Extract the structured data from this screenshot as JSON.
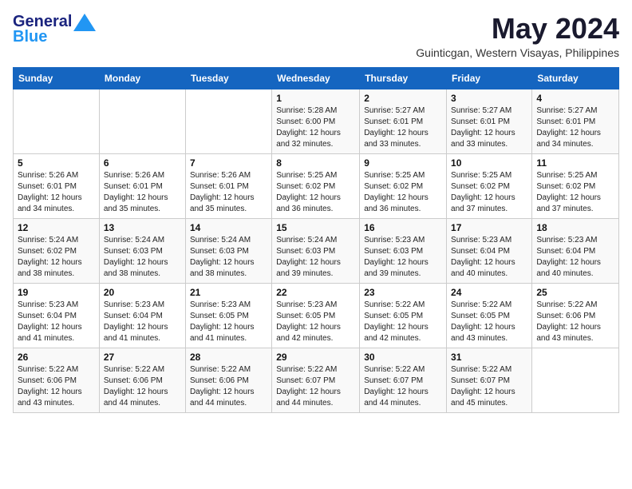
{
  "logo": {
    "general": "General",
    "blue": "Blue",
    "tagline": ""
  },
  "title": {
    "month_year": "May 2024",
    "location": "Guinticgan, Western Visayas, Philippines"
  },
  "header_days": [
    "Sunday",
    "Monday",
    "Tuesday",
    "Wednesday",
    "Thursday",
    "Friday",
    "Saturday"
  ],
  "weeks": [
    [
      {
        "day": "",
        "info": ""
      },
      {
        "day": "",
        "info": ""
      },
      {
        "day": "",
        "info": ""
      },
      {
        "day": "1",
        "info": "Sunrise: 5:28 AM\nSunset: 6:00 PM\nDaylight: 12 hours\nand 32 minutes."
      },
      {
        "day": "2",
        "info": "Sunrise: 5:27 AM\nSunset: 6:01 PM\nDaylight: 12 hours\nand 33 minutes."
      },
      {
        "day": "3",
        "info": "Sunrise: 5:27 AM\nSunset: 6:01 PM\nDaylight: 12 hours\nand 33 minutes."
      },
      {
        "day": "4",
        "info": "Sunrise: 5:27 AM\nSunset: 6:01 PM\nDaylight: 12 hours\nand 34 minutes."
      }
    ],
    [
      {
        "day": "5",
        "info": "Sunrise: 5:26 AM\nSunset: 6:01 PM\nDaylight: 12 hours\nand 34 minutes."
      },
      {
        "day": "6",
        "info": "Sunrise: 5:26 AM\nSunset: 6:01 PM\nDaylight: 12 hours\nand 35 minutes."
      },
      {
        "day": "7",
        "info": "Sunrise: 5:26 AM\nSunset: 6:01 PM\nDaylight: 12 hours\nand 35 minutes."
      },
      {
        "day": "8",
        "info": "Sunrise: 5:25 AM\nSunset: 6:02 PM\nDaylight: 12 hours\nand 36 minutes."
      },
      {
        "day": "9",
        "info": "Sunrise: 5:25 AM\nSunset: 6:02 PM\nDaylight: 12 hours\nand 36 minutes."
      },
      {
        "day": "10",
        "info": "Sunrise: 5:25 AM\nSunset: 6:02 PM\nDaylight: 12 hours\nand 37 minutes."
      },
      {
        "day": "11",
        "info": "Sunrise: 5:25 AM\nSunset: 6:02 PM\nDaylight: 12 hours\nand 37 minutes."
      }
    ],
    [
      {
        "day": "12",
        "info": "Sunrise: 5:24 AM\nSunset: 6:02 PM\nDaylight: 12 hours\nand 38 minutes."
      },
      {
        "day": "13",
        "info": "Sunrise: 5:24 AM\nSunset: 6:03 PM\nDaylight: 12 hours\nand 38 minutes."
      },
      {
        "day": "14",
        "info": "Sunrise: 5:24 AM\nSunset: 6:03 PM\nDaylight: 12 hours\nand 38 minutes."
      },
      {
        "day": "15",
        "info": "Sunrise: 5:24 AM\nSunset: 6:03 PM\nDaylight: 12 hours\nand 39 minutes."
      },
      {
        "day": "16",
        "info": "Sunrise: 5:23 AM\nSunset: 6:03 PM\nDaylight: 12 hours\nand 39 minutes."
      },
      {
        "day": "17",
        "info": "Sunrise: 5:23 AM\nSunset: 6:04 PM\nDaylight: 12 hours\nand 40 minutes."
      },
      {
        "day": "18",
        "info": "Sunrise: 5:23 AM\nSunset: 6:04 PM\nDaylight: 12 hours\nand 40 minutes."
      }
    ],
    [
      {
        "day": "19",
        "info": "Sunrise: 5:23 AM\nSunset: 6:04 PM\nDaylight: 12 hours\nand 41 minutes."
      },
      {
        "day": "20",
        "info": "Sunrise: 5:23 AM\nSunset: 6:04 PM\nDaylight: 12 hours\nand 41 minutes."
      },
      {
        "day": "21",
        "info": "Sunrise: 5:23 AM\nSunset: 6:05 PM\nDaylight: 12 hours\nand 41 minutes."
      },
      {
        "day": "22",
        "info": "Sunrise: 5:23 AM\nSunset: 6:05 PM\nDaylight: 12 hours\nand 42 minutes."
      },
      {
        "day": "23",
        "info": "Sunrise: 5:22 AM\nSunset: 6:05 PM\nDaylight: 12 hours\nand 42 minutes."
      },
      {
        "day": "24",
        "info": "Sunrise: 5:22 AM\nSunset: 6:05 PM\nDaylight: 12 hours\nand 43 minutes."
      },
      {
        "day": "25",
        "info": "Sunrise: 5:22 AM\nSunset: 6:06 PM\nDaylight: 12 hours\nand 43 minutes."
      }
    ],
    [
      {
        "day": "26",
        "info": "Sunrise: 5:22 AM\nSunset: 6:06 PM\nDaylight: 12 hours\nand 43 minutes."
      },
      {
        "day": "27",
        "info": "Sunrise: 5:22 AM\nSunset: 6:06 PM\nDaylight: 12 hours\nand 44 minutes."
      },
      {
        "day": "28",
        "info": "Sunrise: 5:22 AM\nSunset: 6:06 PM\nDaylight: 12 hours\nand 44 minutes."
      },
      {
        "day": "29",
        "info": "Sunrise: 5:22 AM\nSunset: 6:07 PM\nDaylight: 12 hours\nand 44 minutes."
      },
      {
        "day": "30",
        "info": "Sunrise: 5:22 AM\nSunset: 6:07 PM\nDaylight: 12 hours\nand 44 minutes."
      },
      {
        "day": "31",
        "info": "Sunrise: 5:22 AM\nSunset: 6:07 PM\nDaylight: 12 hours\nand 45 minutes."
      },
      {
        "day": "",
        "info": ""
      }
    ]
  ]
}
